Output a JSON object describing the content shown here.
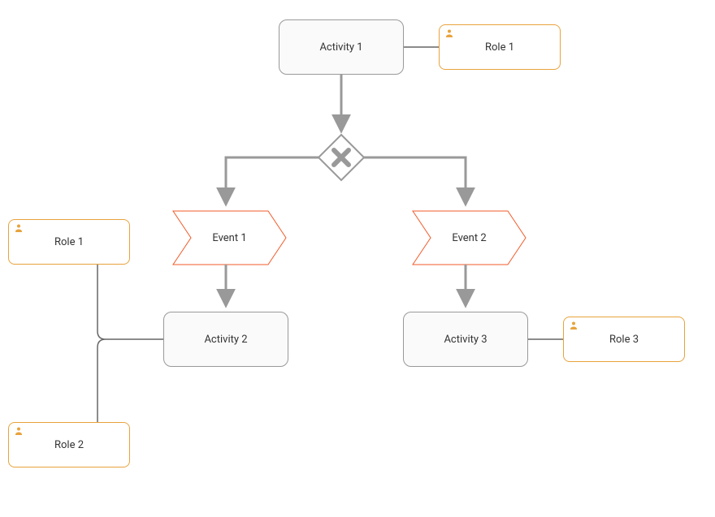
{
  "colors": {
    "activity_border": "#999999",
    "activity_fill": "#fafafa",
    "role_border": "#e8a33d",
    "event_border": "#f15a29",
    "connector": "#999999",
    "connector_thin": "#666666",
    "gateway_icon": "#999999"
  },
  "nodes": {
    "activity1": {
      "label": "Activity 1"
    },
    "activity2": {
      "label": "Activity 2"
    },
    "activity3": {
      "label": "Activity 3"
    },
    "role_top": {
      "label": "Role 1"
    },
    "role_left1": {
      "label": "Role 1"
    },
    "role_left2": {
      "label": "Role 2"
    },
    "role_right": {
      "label": "Role 3"
    },
    "event1": {
      "label": "Event 1"
    },
    "event2": {
      "label": "Event 2"
    },
    "gateway": {
      "type": "exclusive"
    }
  },
  "edges": [
    {
      "from": "activity1",
      "to": "gateway",
      "style": "arrow"
    },
    {
      "from": "gateway",
      "to": "event1",
      "style": "arrow-elbow"
    },
    {
      "from": "gateway",
      "to": "event2",
      "style": "arrow-elbow"
    },
    {
      "from": "event1",
      "to": "activity2",
      "style": "arrow"
    },
    {
      "from": "event2",
      "to": "activity3",
      "style": "arrow"
    },
    {
      "from": "activity1",
      "to": "role_top",
      "style": "line"
    },
    {
      "from": "activity2",
      "to": "role_left1",
      "style": "line"
    },
    {
      "from": "activity2",
      "to": "role_left2",
      "style": "line"
    },
    {
      "from": "activity3",
      "to": "role_right",
      "style": "line"
    }
  ]
}
